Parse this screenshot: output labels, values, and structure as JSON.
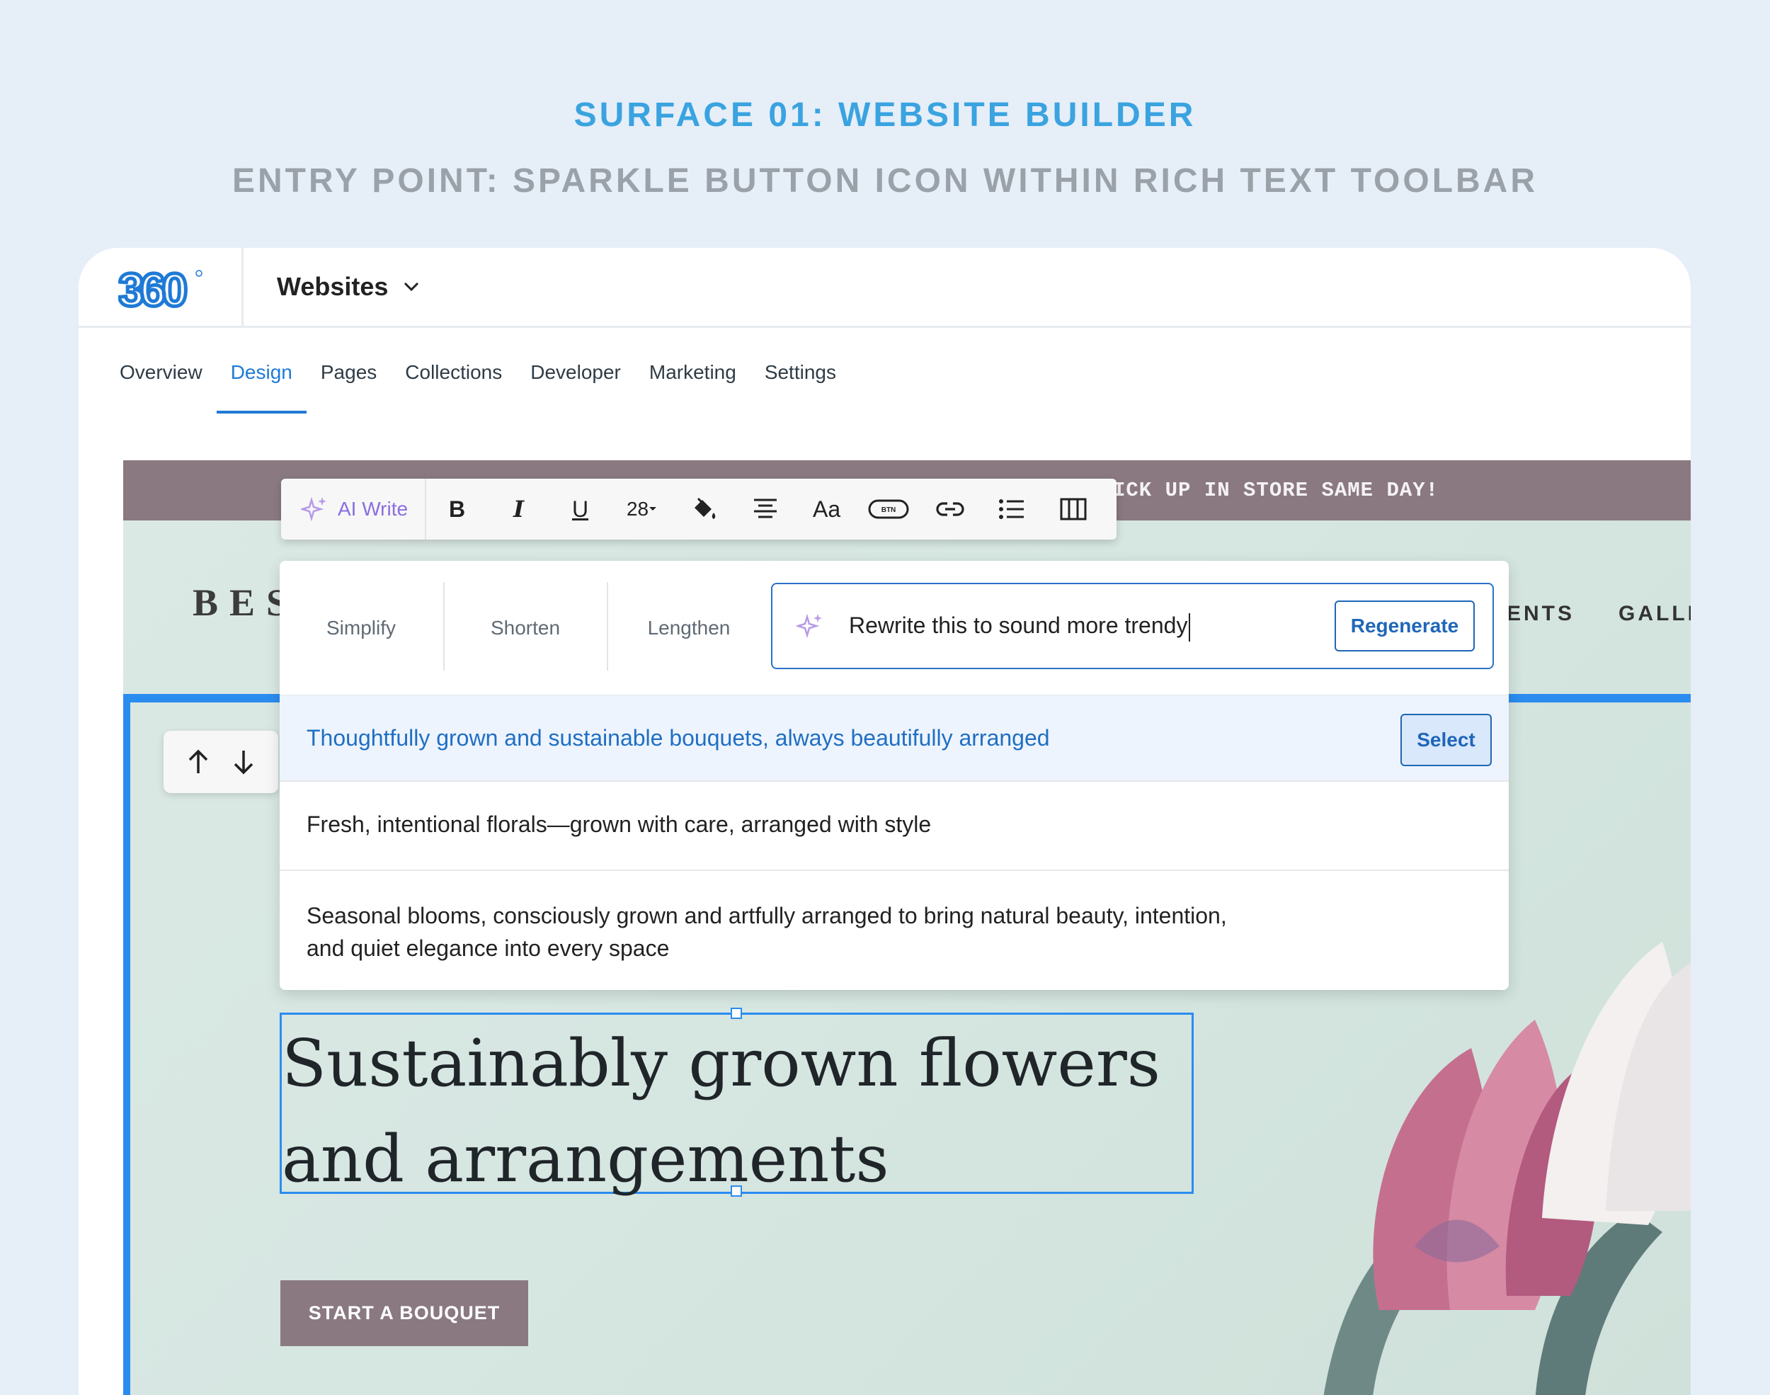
{
  "heading": {
    "title": "SURFACE 01: WEBSITE BUILDER",
    "subtitle": "ENTRY POINT: SPARKLE BUTTON ICON WITHIN RICH TEXT TOOLBAR"
  },
  "app": {
    "logo_text": "360",
    "site_selector": "Websites",
    "tabs": [
      {
        "label": "Overview"
      },
      {
        "label": "Design",
        "active": true
      },
      {
        "label": "Pages"
      },
      {
        "label": "Collections"
      },
      {
        "label": "Developer"
      },
      {
        "label": "Marketing"
      },
      {
        "label": "Settings"
      }
    ],
    "accent_color": "#1f7ad6"
  },
  "site": {
    "promo_text": "ICK UP IN STORE SAME DAY!",
    "brand_partial": "BES",
    "nav_items": [
      "ENTS",
      "GALLI"
    ],
    "headline_line1": "Sustainably grown flowers",
    "headline_line2": "and arrangements",
    "cta_label": "START A BOUQUET",
    "promo_color": "#8a7981"
  },
  "toolbar": {
    "ai_write_label": "AI Write",
    "font_size": "28",
    "icons": [
      "bold-icon",
      "italic-icon",
      "underline-icon",
      "font-size-dropdown",
      "fill-color-icon",
      "align-center-icon",
      "text-style-icon",
      "button-icon",
      "link-icon",
      "bullet-list-icon",
      "columns-icon"
    ],
    "btn_icon_text": "BTN",
    "text_style_label": "Aa"
  },
  "ai_panel": {
    "options": [
      "Simplify",
      "Shorten",
      "Lengthen"
    ],
    "prompt_value": "Rewrite this to sound more trendy",
    "regenerate_label": "Regenerate",
    "select_label": "Select",
    "suggestions": [
      "Thoughtfully grown and sustainable bouquets, always beautifully arranged",
      "Fresh, intentional florals—grown with care, arranged with style",
      "Seasonal blooms, consciously grown and artfully arranged to bring natural beauty, intention,",
      "and quiet elegance into every space"
    ]
  }
}
